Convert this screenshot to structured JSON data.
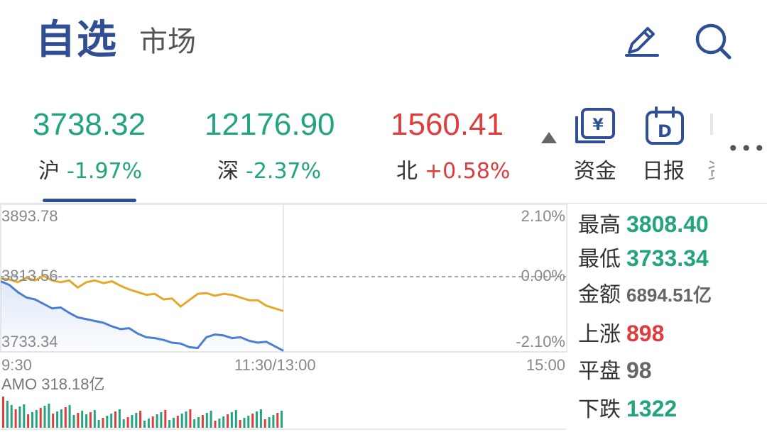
{
  "header": {
    "title": "自选",
    "subtitle": "市场",
    "edit_icon": "pencil-icon",
    "search_icon": "search-icon"
  },
  "indices": [
    {
      "value": "3738.32",
      "name": "沪",
      "change": "-1.97%",
      "color": "#22a47f",
      "active": true
    },
    {
      "value": "12176.90",
      "name": "深",
      "change": "-2.37%",
      "color": "#22a47f"
    },
    {
      "value": "1560.41",
      "name": "北",
      "change": "+0.58%",
      "color": "#e03c3c"
    }
  ],
  "tools": [
    {
      "label": "资金",
      "icon": "yen-card-icon"
    },
    {
      "label": "日报",
      "icon": "calendar-d-icon"
    },
    {
      "label": "资"
    }
  ],
  "more_icon": "more-dots-icon",
  "colors": {
    "brand": "#2f4e93",
    "up": "#e03c3c",
    "down": "#22a47f",
    "index_line": "#4a7fd4",
    "avg_line": "#e6a82b"
  },
  "chart": {
    "price_high_label": "3893.78",
    "price_mid_label": "3813.56",
    "price_low_label": "3733.34",
    "pct_high_label": "2.10%",
    "pct_mid_label": "0.00%",
    "pct_low_label": "-2.10%",
    "time_start": "9:30",
    "time_mid": "11:30/13:00",
    "time_end": "15:00",
    "volume_label": "AMO 318.18亿"
  },
  "chart_data": {
    "type": "line",
    "title": "",
    "xlabel": "",
    "ylabel": "",
    "x_ticks": [
      "9:30",
      "11:30/13:00",
      "15:00"
    ],
    "ylim": [
      3733.34,
      3893.78
    ],
    "y_ticks": [
      3893.78,
      3813.56,
      3733.34
    ],
    "y2_ticks": [
      "2.10%",
      "0.00%",
      "-2.10%"
    ],
    "prev_close": 3813.56,
    "session_progress_pct": 50,
    "series": [
      {
        "values": [
          3810,
          3806,
          3798,
          3792,
          3790,
          3785,
          3780,
          3781,
          3775,
          3770,
          3768,
          3766,
          3764,
          3760,
          3757,
          3758,
          3752,
          3748,
          3747,
          3745,
          3742,
          3741,
          3737,
          3736,
          3748,
          3751,
          3750,
          3747,
          3748,
          3744,
          3742,
          3743,
          3738,
          3733
        ]
      },
      {
        "values": [
          3813,
          3812,
          3809,
          3814,
          3811,
          3816,
          3811,
          3809,
          3811,
          3803,
          3809,
          3811,
          3808,
          3810,
          3805,
          3801,
          3798,
          3795,
          3796,
          3790,
          3791,
          3782,
          3789,
          3796,
          3797,
          3794,
          3796,
          3795,
          3792,
          3789,
          3789,
          3783,
          3780,
          3777
        ]
      }
    ],
    "volume_bars": 34
  },
  "stats": [
    {
      "label": "最高",
      "value": "3808.40",
      "color": "#22a47f"
    },
    {
      "label": "最低",
      "value": "3733.34",
      "color": "#22a47f"
    },
    {
      "label": "金额",
      "value": "6894.51亿",
      "color": "#666666"
    },
    {
      "label": "上涨",
      "value": "898",
      "color": "#e03c3c"
    },
    {
      "label": "平盘",
      "value": "98",
      "color": "#666666"
    },
    {
      "label": "下跌",
      "value": "1322",
      "color": "#22a47f"
    }
  ]
}
